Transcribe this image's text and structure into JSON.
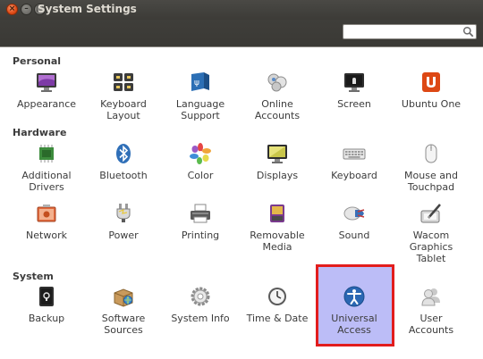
{
  "window": {
    "title": "System Settings"
  },
  "search": {
    "value": "",
    "placeholder": ""
  },
  "sections": {
    "personal": "Personal",
    "hardware": "Hardware",
    "system": "System"
  },
  "items": {
    "appearance": "Appearance",
    "keyboard_layout": "Keyboard\nLayout",
    "language_support": "Language\nSupport",
    "online_accounts": "Online\nAccounts",
    "screen": "Screen",
    "ubuntu_one": "Ubuntu One",
    "additional_drivers": "Additional\nDrivers",
    "bluetooth": "Bluetooth",
    "color": "Color",
    "displays": "Displays",
    "keyboard": "Keyboard",
    "mouse_touchpad": "Mouse and\nTouchpad",
    "network": "Network",
    "power": "Power",
    "printing": "Printing",
    "removable_media": "Removable\nMedia",
    "sound": "Sound",
    "wacom": "Wacom\nGraphics\nTablet",
    "backup": "Backup",
    "software_sources": "Software\nSources",
    "system_info": "System Info",
    "time_date": "Time & Date",
    "universal_access": "Universal\nAccess",
    "user_accounts": "User\nAccounts"
  },
  "colors": {
    "highlight_fill": "#bcbdf7",
    "highlight_border": "#e21d1d",
    "titlebar": "#3c3b37",
    "close_button": "#df4a16"
  },
  "selected_item": "universal_access"
}
